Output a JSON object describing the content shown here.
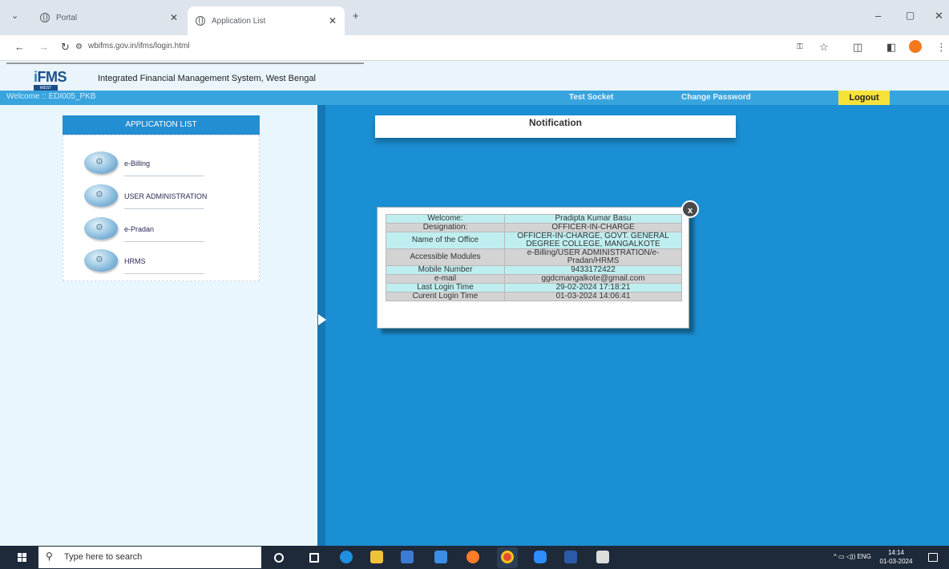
{
  "browser": {
    "tabs": [
      {
        "label": "Portal",
        "active": false
      },
      {
        "label": "Application List",
        "active": true
      }
    ],
    "url": "wbifms.gov.in/ifms/login.html"
  },
  "header": {
    "logo_text_i": "i",
    "logo_text_rest": "FMS",
    "logo_sub": "WEST BENGAL",
    "title": "Integrated Financial Management System, West Bengal"
  },
  "userbar": {
    "welcome": "Welcome :: EDI005_PKB",
    "test_socket": "Test Socket",
    "change_password": "Change Password",
    "logout": "Logout"
  },
  "applist": {
    "heading": "APPLICATION LIST",
    "items": [
      "e-Billing",
      "USER ADMINISTRATION",
      "e-Pradan",
      "HRMS"
    ]
  },
  "notification": {
    "title": "Notification"
  },
  "popup": {
    "close": "x",
    "rows": [
      {
        "key": "Welcome:",
        "value": "Pradipta Kumar Basu"
      },
      {
        "key": "Designation:",
        "value": "OFFICER-IN-CHARGE"
      },
      {
        "key": "Name of the Office",
        "value": "OFFICER-IN-CHARGE, GOVT. GENERAL DEGREE COLLEGE, MANGALKOTE"
      },
      {
        "key": "Accessible Modules",
        "value": "e-Billing/USER ADMINISTRATION/e-Pradan/HRMS"
      },
      {
        "key": "Mobile Number",
        "value": "9433172422"
      },
      {
        "key": "e-mail",
        "value": "ggdcmangalkote@gmail.com"
      },
      {
        "key": "Last Login Time",
        "value": "29-02-2024 17:18:21"
      },
      {
        "key": "Curent Login Time",
        "value": "01-03-2024 14:06:41"
      }
    ]
  },
  "taskbar": {
    "search_placeholder": "Type here to search",
    "tray_lang": "ENG",
    "time": "14:14",
    "date": "01-03-2024"
  },
  "colors": {
    "userbar": "#38a4de",
    "right_pane": "#1b8fd3",
    "logout_button": "#f7e23a",
    "row_cyan": "#bfeef0",
    "row_grey": "#d3d3d3"
  }
}
